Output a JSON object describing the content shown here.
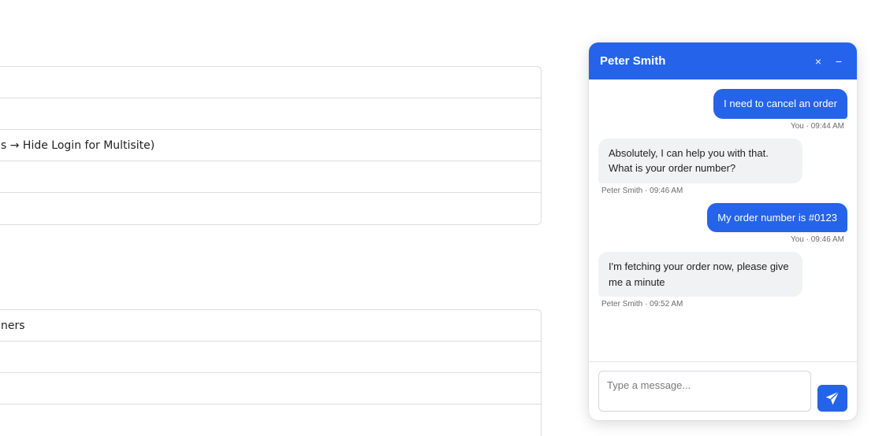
{
  "background": {
    "table1_rows": [
      "",
      "",
      "s → Hide Login for Multisite)",
      "",
      ""
    ],
    "table2_rows": [
      "ners",
      "",
      "",
      ""
    ]
  },
  "chat": {
    "agent_name": "Peter Smith",
    "close_symbol": "×",
    "minimize_symbol": "−",
    "messages": [
      {
        "direction": "out",
        "text": "I need to cancel an order",
        "meta": "You · 09:44 AM"
      },
      {
        "direction": "in",
        "text": "Absolutely, I can help you with that. What is your order number?",
        "meta": "Peter Smith · 09:46 AM"
      },
      {
        "direction": "out",
        "text": "My order number is #0123",
        "meta": "You · 09:46 AM"
      },
      {
        "direction": "in",
        "text": "I'm fetching your order now, please give me a minute",
        "meta": "Peter Smith · 09:52 AM"
      }
    ],
    "input_placeholder": "Type a message...",
    "accent_color": "#2563eb",
    "send_icon": "send-icon"
  }
}
